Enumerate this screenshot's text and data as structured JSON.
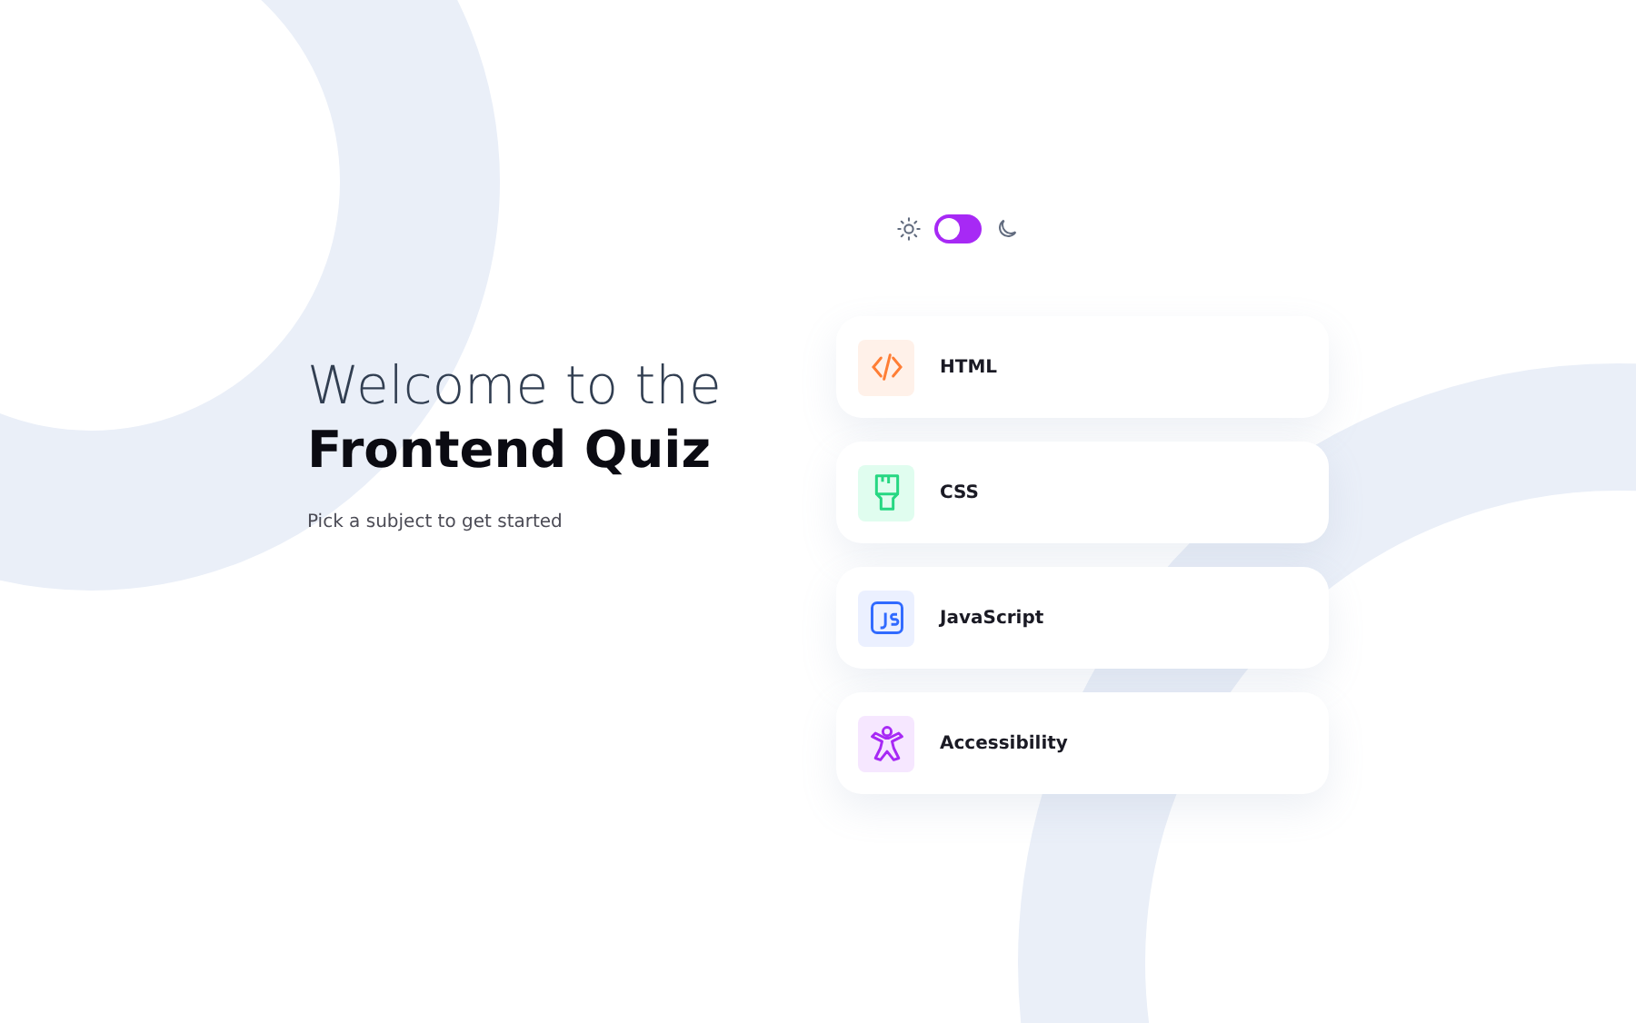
{
  "theme_toggle": {
    "dark_mode": false
  },
  "intro": {
    "line_1": "Welcome to the",
    "line_2": "Frontend Quiz",
    "subtitle": "Pick a subject to get started"
  },
  "subjects": [
    {
      "kind": "html",
      "label": "HTML",
      "color": "#fff1e9"
    },
    {
      "kind": "css",
      "label": "CSS",
      "color": "#e0fdef"
    },
    {
      "kind": "js",
      "label": "JavaScript",
      "color": "#ebf0ff"
    },
    {
      "kind": "a11y",
      "label": "Accessibility",
      "color": "#f6e7ff"
    }
  ]
}
